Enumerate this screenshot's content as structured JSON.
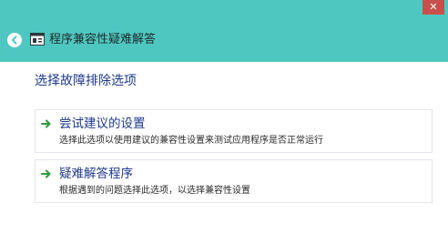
{
  "window": {
    "title": "程序兼容性疑难解答",
    "close_label": "✕",
    "header_color": "#4fc7c1"
  },
  "icons": {
    "back": "back-arrow-icon",
    "app": "compatibility-troubleshooter-icon",
    "option_arrow": "green-arrow-icon"
  },
  "content": {
    "heading": "选择故障排除选项",
    "options": [
      {
        "title": "尝试建议的设置",
        "description": "选择此选项以使用建议的兼容性设置来测试应用程序是否正常运行"
      },
      {
        "title": "疑难解答程序",
        "description": "根据遇到的问题选择此选项，以选择兼容性设置"
      }
    ]
  }
}
